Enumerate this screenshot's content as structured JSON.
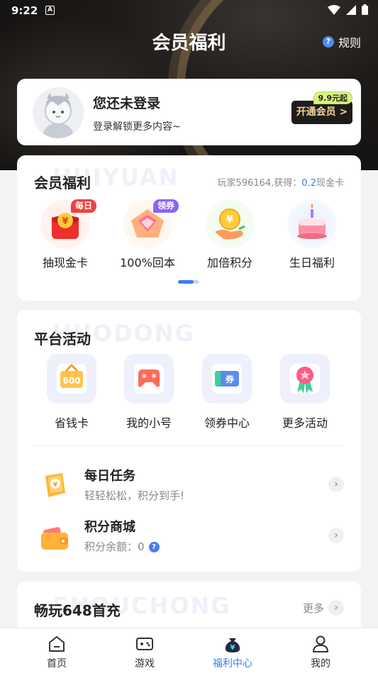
{
  "status": {
    "time": "9:22",
    "a_badge": "A"
  },
  "header": {
    "title": "会员福利",
    "rules_label": "规则",
    "rules_icon": "question-icon"
  },
  "login": {
    "title": "您还未登录",
    "subtitle": "登录解锁更多内容~",
    "vip_button": "开通会员 >",
    "vip_badge": "9.9元起"
  },
  "benefits": {
    "title": "会员福利",
    "ghost": "HUIYUAN",
    "info_prefix": "玩家596164,获得：",
    "info_value": "0.2",
    "info_suffix": "现金卡",
    "items": [
      {
        "label": "抽现金卡",
        "tag": "每日",
        "tag_color": "#f0403c",
        "icon": "red-envelope-icon"
      },
      {
        "label": "100%回本",
        "tag": "领券",
        "tag_color": "#8a63f5",
        "icon": "diamond-icon"
      },
      {
        "label": "加倍积分",
        "tag": "",
        "icon": "coin-hand-icon"
      },
      {
        "label": "生日福利",
        "tag": "",
        "icon": "birthday-cake-icon"
      }
    ]
  },
  "platform": {
    "title": "平台活动",
    "ghost": "HUODONG",
    "items": [
      {
        "label": "省钱卡",
        "icon": "savings-card-icon",
        "icon_text": "600"
      },
      {
        "label": "我的小号",
        "icon": "gamepad-icon"
      },
      {
        "label": "领券中心",
        "icon": "coupon-icon",
        "icon_text": "券"
      },
      {
        "label": "更多活动",
        "icon": "badge-ribbon-icon"
      }
    ],
    "tasks": [
      {
        "title": "每日任务",
        "subtitle": "轻轻松松，积分到手!",
        "icon": "ticket-icon"
      },
      {
        "title": "积分商城",
        "subtitle": "积分余额：0",
        "icon": "wallet-icon"
      }
    ]
  },
  "recharge": {
    "title": "畅玩648首充",
    "ghost": "SHOUCHONG",
    "more_label": "更多"
  },
  "tabbar": {
    "items": [
      {
        "label": "首页",
        "icon": "home-icon"
      },
      {
        "label": "游戏",
        "icon": "gamepad-icon"
      },
      {
        "label": "福利中心",
        "icon": "money-bag-icon",
        "active": true
      },
      {
        "label": "我的",
        "icon": "user-icon"
      }
    ]
  },
  "colors": {
    "accent": "#3d7bf0",
    "hero_bg": "#1d1a18",
    "vip_gold": "#f4d49a"
  }
}
